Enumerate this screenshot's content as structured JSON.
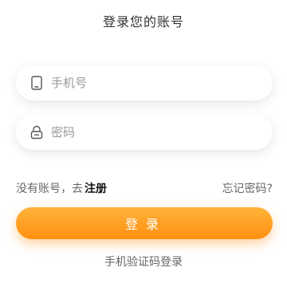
{
  "header": {
    "title": "登录您的账号"
  },
  "form": {
    "phone": {
      "placeholder": "手机号",
      "icon": "phone-icon"
    },
    "password": {
      "placeholder": "密码",
      "icon": "lock-icon"
    }
  },
  "links": {
    "no_account_prefix": "没有账号，去",
    "register_label": "注册",
    "forgot_password": "忘记密码?"
  },
  "login_button": {
    "label": "登录"
  },
  "sms_login": {
    "label": "手机验证码登录"
  },
  "colors": {
    "accent": "#ff9a1f",
    "accent_light": "#ffb33a",
    "text_primary": "#333333",
    "text_secondary": "#666666",
    "placeholder": "#9a9a9a"
  }
}
